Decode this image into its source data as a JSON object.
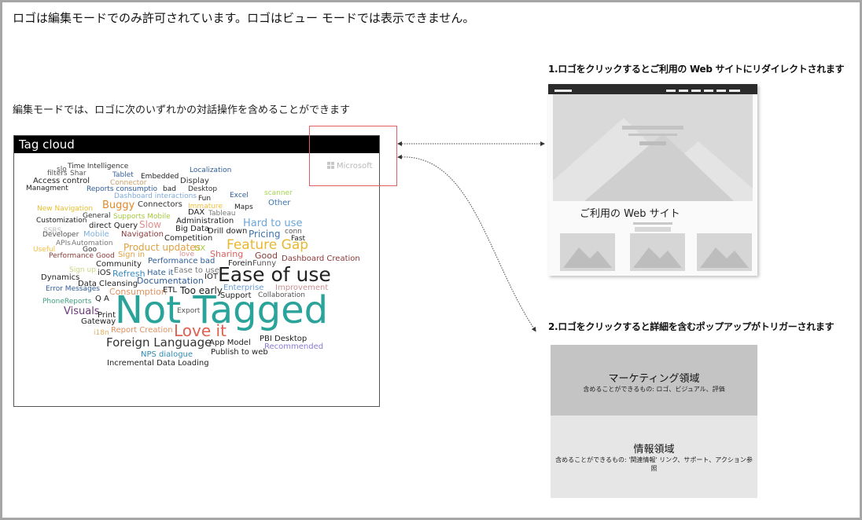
{
  "heading": "ロゴは編集モードでのみ許可されています。ロゴはビュー モードでは表示できません。",
  "subheading": "編集モードでは、ロゴに次のいずれかの対話操作を含めることができます",
  "option1_label": "1.ロゴをクリックするとご利用の Web サイトにリダイレクトされます",
  "option2_label": "2.ロゴをクリックすると詳細を含むポップアップがトリガーされます",
  "tag_cloud": {
    "title": "Tag cloud",
    "words": [
      {
        "text": "Time Intelligence",
        "color": "#333333"
      },
      {
        "text": "slo",
        "color": "#555555"
      },
      {
        "text": "filters",
        "color": "#555555"
      },
      {
        "text": "Shar",
        "color": "#555555"
      },
      {
        "text": "Tablet",
        "color": "#3a62a7"
      },
      {
        "text": "Embedded",
        "color": "#222222"
      },
      {
        "text": "Localization",
        "color": "#2e5c9a"
      },
      {
        "text": "Access control",
        "color": "#222222"
      },
      {
        "text": "Connector",
        "color": "#c8a06a"
      },
      {
        "text": "Display",
        "color": "#333333"
      },
      {
        "text": "Managment",
        "color": "#222222"
      },
      {
        "text": "Reports consumptio",
        "color": "#2e5c9a"
      },
      {
        "text": "bad",
        "color": "#222222"
      },
      {
        "text": "Desktop",
        "color": "#333333"
      },
      {
        "text": "scanner",
        "color": "#a6d64f"
      },
      {
        "text": "Dashboard interactions",
        "color": "#7fa8d8"
      },
      {
        "text": "Excel",
        "color": "#2e5c9a"
      },
      {
        "text": "Fun",
        "color": "#222222"
      },
      {
        "text": "Other",
        "color": "#3a74b0"
      },
      {
        "text": "Buggy",
        "color": "#e08a2a"
      },
      {
        "text": "Connectors",
        "color": "#333333"
      },
      {
        "text": "Immature",
        "color": "#f0c040"
      },
      {
        "text": "Maps",
        "color": "#222222"
      },
      {
        "text": "New Navigation",
        "color": "#e8c030"
      },
      {
        "text": "DAX",
        "color": "#222222"
      },
      {
        "text": "Tableau",
        "color": "#777777"
      },
      {
        "text": "General",
        "color": "#333333"
      },
      {
        "text": "Supports Mobile",
        "color": "#a6c840"
      },
      {
        "text": "Customization",
        "color": "#222222"
      },
      {
        "text": "Slow",
        "color": "#e09090"
      },
      {
        "text": "Administration",
        "color": "#222222"
      },
      {
        "text": "Hard to use",
        "color": "#6aa6d8"
      },
      {
        "text": "direct Query",
        "color": "#222222"
      },
      {
        "text": "Big Data",
        "color": "#222222"
      },
      {
        "text": "conn",
        "color": "#555555"
      },
      {
        "text": "SSRS",
        "color": "#bbbbbb"
      },
      {
        "text": "Drill down",
        "color": "#222222"
      },
      {
        "text": "Pricing",
        "color": "#3a74b0"
      },
      {
        "text": "Developer",
        "color": "#555555"
      },
      {
        "text": "Mobile",
        "color": "#7fb0e0"
      },
      {
        "text": "Navigation",
        "color": "#8a3a3a"
      },
      {
        "text": "Fast",
        "color": "#222222"
      },
      {
        "text": "APIs",
        "color": "#777777"
      },
      {
        "text": "Automation",
        "color": "#777777"
      },
      {
        "text": "Competition",
        "color": "#222222"
      },
      {
        "text": "Useful",
        "color": "#f0c040"
      },
      {
        "text": "Goo",
        "color": "#333333"
      },
      {
        "text": "Product updates",
        "color": "#e0a040"
      },
      {
        "text": "UX",
        "color": "#a6c840"
      },
      {
        "text": "Feature Gap",
        "color": "#e8b830"
      },
      {
        "text": "Performance",
        "color": "#8a3a3a"
      },
      {
        "text": "Good",
        "color": "#8a3a3a"
      },
      {
        "text": "Sign in",
        "color": "#e0a040"
      },
      {
        "text": "love",
        "color": "#e09090"
      },
      {
        "text": "Sharing",
        "color": "#e06060"
      },
      {
        "text": "Good",
        "color": "#8a3a3a"
      },
      {
        "text": "Dashboard Creation",
        "color": "#8a3a3a"
      },
      {
        "text": "Community",
        "color": "#222222"
      },
      {
        "text": "Performance bad",
        "color": "#2e5c9a"
      },
      {
        "text": "Forein",
        "color": "#222222"
      },
      {
        "text": "Funny",
        "color": "#555555"
      },
      {
        "text": "Sign up",
        "color": "#c8d880"
      },
      {
        "text": "iOS",
        "color": "#222222"
      },
      {
        "text": "Refresh",
        "color": "#3a8ac0"
      },
      {
        "text": "Hate it",
        "color": "#2e5c9a"
      },
      {
        "text": "Ease to use",
        "color": "#777777"
      },
      {
        "text": "Dynamics",
        "color": "#222222"
      },
      {
        "text": "IOT",
        "color": "#222222"
      },
      {
        "text": "Ease of use",
        "color": "#222222"
      },
      {
        "text": "Documentation",
        "color": "#2e5c9a"
      },
      {
        "text": "Data Cleansing",
        "color": "#222222"
      },
      {
        "text": "Error Messages",
        "color": "#2e5c9a"
      },
      {
        "text": "Consumption",
        "color": "#e09060"
      },
      {
        "text": "ETL",
        "color": "#222222"
      },
      {
        "text": "Too early",
        "color": "#222222"
      },
      {
        "text": "Enterprise",
        "color": "#6a9ad8"
      },
      {
        "text": "Improvement",
        "color": "#c89090"
      },
      {
        "text": "Support",
        "color": "#222222"
      },
      {
        "text": "Collaboration",
        "color": "#555555"
      },
      {
        "text": "PhoneReports",
        "color": "#40a080"
      },
      {
        "text": "Q A",
        "color": "#222222"
      },
      {
        "text": "Not Tagged",
        "color": "#2aa39a"
      },
      {
        "text": "Visuals",
        "color": "#6a3a7a"
      },
      {
        "text": "Print",
        "color": "#222222"
      },
      {
        "text": "Export",
        "color": "#555555"
      },
      {
        "text": "Gateway",
        "color": "#222222"
      },
      {
        "text": "Report Creation",
        "color": "#e09060"
      },
      {
        "text": "Love it",
        "color": "#e06050"
      },
      {
        "text": "i18n",
        "color": "#e0b060"
      },
      {
        "text": "PBI Desktop",
        "color": "#222222"
      },
      {
        "text": "Foreign Language",
        "color": "#333333"
      },
      {
        "text": "App Model",
        "color": "#222222"
      },
      {
        "text": "Recommended",
        "color": "#8a7ad0"
      },
      {
        "text": "NPS dialogue",
        "color": "#2e8ab0"
      },
      {
        "text": "Publish to web",
        "color": "#222222"
      },
      {
        "text": "Incremental Data Loading",
        "color": "#222222"
      }
    ]
  },
  "logo_text": "Microsoft",
  "website_caption": "ご利用の Web サイト",
  "popup": {
    "section1_title": "マーケティング領域",
    "section1_text": "含めることができるもの: ロゴ、ビジュアル、評価",
    "section2_title": "情報領域",
    "section2_text": "含めることができるもの: '関連情報' リンク、サポート、アクション参照"
  },
  "colors": {
    "frame": "#a6a6a6",
    "logo_highlight": "#e06060",
    "cloud_header": "#000000"
  }
}
